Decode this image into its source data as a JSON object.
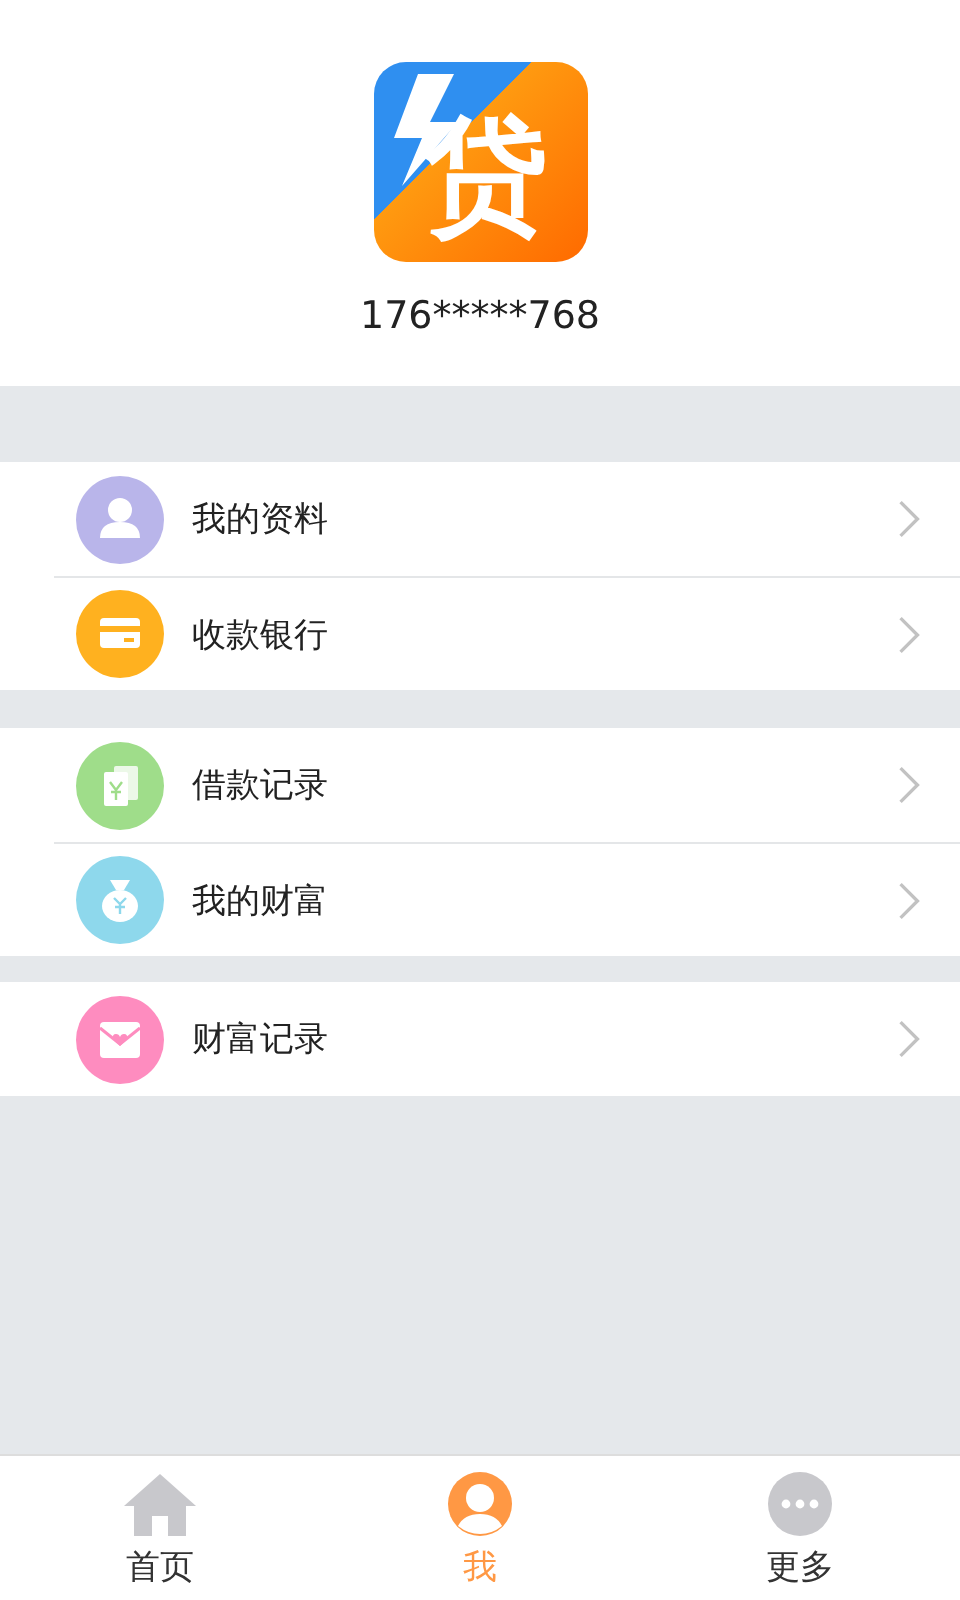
{
  "profile": {
    "logo_text": "贷",
    "phone": "176*****768"
  },
  "menu_groups": [
    {
      "items": [
        {
          "label": "我的资料",
          "kind": "person",
          "color": "#b9b5ea"
        },
        {
          "label": "收款银行",
          "kind": "card",
          "color": "#ffb11f"
        }
      ]
    },
    {
      "items": [
        {
          "label": "借款记录",
          "kind": "note",
          "color": "#9fdd8a"
        },
        {
          "label": "我的财富",
          "kind": "bag",
          "color": "#8ed8ec"
        }
      ]
    },
    {
      "items": [
        {
          "label": "财富记录",
          "kind": "envelope",
          "color": "#fe8cbf"
        }
      ]
    }
  ],
  "tab_bar": [
    {
      "label": "首页",
      "kind": "home",
      "selected": false
    },
    {
      "label": "我",
      "kind": "me",
      "selected": true
    },
    {
      "label": "更多",
      "kind": "more",
      "selected": false
    }
  ]
}
